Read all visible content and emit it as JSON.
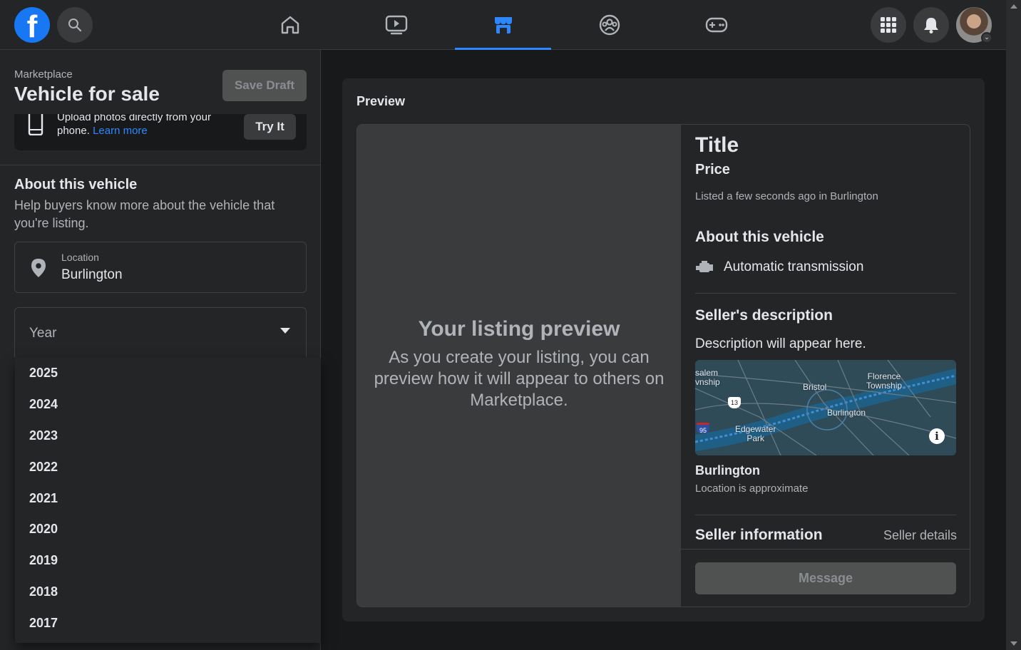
{
  "topbar": {
    "logo_icon": "facebook-logo",
    "search_icon": "search-icon",
    "nav_icons": [
      "home-icon",
      "watch-icon",
      "marketplace-icon",
      "groups-icon",
      "gaming-icon"
    ],
    "active_tab": "marketplace",
    "right_icons": [
      "menu-grid-icon",
      "notifications-bell-icon"
    ],
    "accent_color": "#2d88ff"
  },
  "sidebar": {
    "breadcrumb": "Marketplace",
    "title": "Vehicle for sale",
    "save_draft_label": "Save Draft",
    "upload_text": "Upload photos directly from your phone.",
    "upload_link": "Learn more",
    "try_it_label": "Try It",
    "about_heading": "About this vehicle",
    "about_subtext": "Help buyers know more about the vehicle that you're listing.",
    "location_label": "Location",
    "location_value": "Burlington",
    "year_label": "Year",
    "year_options": [
      "2025",
      "2024",
      "2023",
      "2022",
      "2021",
      "2020",
      "2019",
      "2018",
      "2017"
    ]
  },
  "preview": {
    "heading": "Preview",
    "placeholder_title": "Your listing preview",
    "placeholder_sub": "As you create your listing, you can preview how it will appear to others on Marketplace.",
    "title": "Title",
    "price": "Price",
    "listed": "Listed a few seconds ago in Burlington",
    "about_heading": "About this vehicle",
    "transmission": "Automatic transmission",
    "seller_desc_heading": "Seller's description",
    "description": "Description will appear here.",
    "map_labels": {
      "salem": "salem\nvnship",
      "bristol": "Bristol",
      "florence": "Florence\nTownship",
      "burlington": "Burlington",
      "edgewater": "Edgewater\nPark",
      "route13": "13",
      "i95": "95"
    },
    "city": "Burlington",
    "approx": "Location is approximate",
    "seller_info_heading": "Seller information",
    "seller_details_link": "Seller details",
    "message_label": "Message"
  }
}
